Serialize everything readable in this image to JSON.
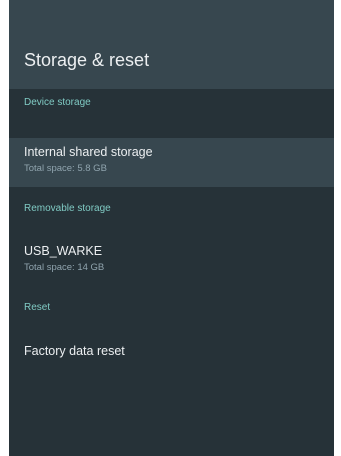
{
  "header": {
    "title": "Storage & reset"
  },
  "sections": [
    {
      "label": "Device storage"
    },
    {
      "label": "Removable storage"
    },
    {
      "label": "Reset"
    }
  ],
  "items": [
    {
      "title": "Internal shared storage",
      "subtitle": "Total space: 5.8 GB",
      "focused": true
    },
    {
      "title": "USB_WARKE",
      "subtitle": "Total space: 14 GB",
      "focused": false
    },
    {
      "title": "Factory data reset",
      "focused": false
    }
  ],
  "colors": {
    "panel_bg": "#263238",
    "header_bg": "#37474f",
    "section_accent": "#80cbc4",
    "focused_bg": "#37474f"
  }
}
